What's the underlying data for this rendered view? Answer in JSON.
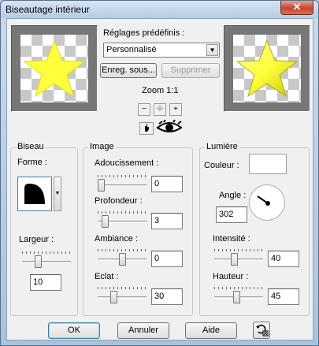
{
  "window": {
    "title": "Biseautage intérieur",
    "close_symbol": "✕"
  },
  "presets": {
    "label": "Réglages prédéfinis :",
    "value": "Personnalisé",
    "save_label": "Enreg. sous...",
    "delete_label": "Supprimer"
  },
  "zoom": {
    "label": "Zoom 1:1",
    "zoom_out": "−",
    "fit": "✥",
    "zoom_in": "+"
  },
  "biseau": {
    "title": "Biseau",
    "forme_label": "Forme :",
    "largeur_label": "Largeur :",
    "largeur_value": "10",
    "largeur_level": 0.3
  },
  "image": {
    "title": "Image",
    "adoucissement_label": "Adoucissement :",
    "adoucissement_value": "0",
    "adoucissement_level": 0,
    "profondeur_label": "Profondeur :",
    "profondeur_value": "3",
    "profondeur_level": 0.1,
    "ambiance_label": "Ambiance :",
    "ambiance_value": "0",
    "ambiance_level": 0.5,
    "eclat_label": "Eclat :",
    "eclat_value": "30",
    "eclat_level": 0.3
  },
  "lumiere": {
    "title": "Lumière",
    "couleur_label": "Couleur :",
    "couleur_value": "#ffffff",
    "angle_label": "Angle :",
    "angle_value": "302",
    "intensite_label": "Intensité :",
    "intensite_value": "40",
    "intensite_level": 0.4,
    "hauteur_label": "Hauteur :",
    "hauteur_value": "45",
    "hauteur_level": 0.45
  },
  "buttons": {
    "ok": "OK",
    "cancel": "Annuler",
    "help": "Aide"
  },
  "colors": {
    "star_fill": "#ffff3c",
    "star_shadow": "#c8c800",
    "preview_bg": "#777777",
    "accent": "#3c7fb1"
  }
}
